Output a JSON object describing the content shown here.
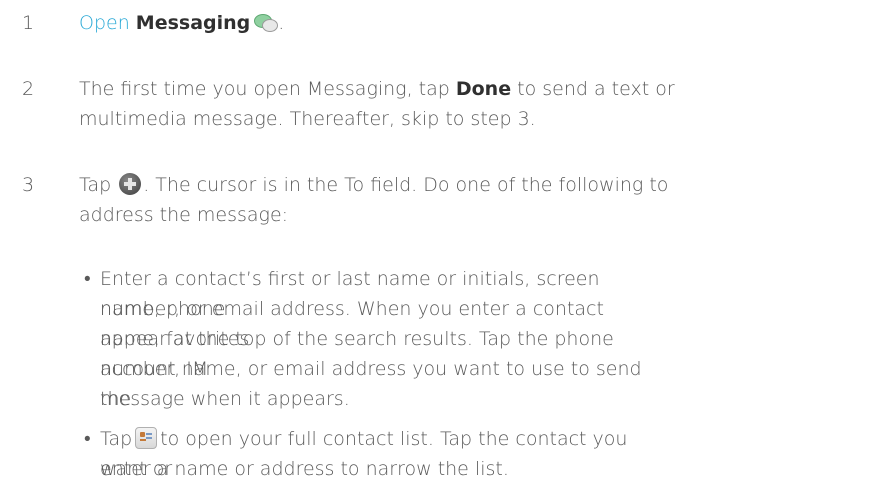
{
  "steps": [
    {
      "number": "1",
      "open_word": "Open",
      "app_name": "Messaging",
      "icon": "messaging-icon",
      "end": "."
    },
    {
      "number": "2",
      "before": "The first time you open Messaging, tap",
      "bold": "Done",
      "after_line1": "to send a text or",
      "line2": "multimedia message. Thereafter, skip to step 3."
    },
    {
      "number": "3",
      "tap": "Tap",
      "icon": "new-message-icon",
      "after_line1": ". The cursor is in the To field. Do one of the following to",
      "line2": "address the message:"
    }
  ],
  "bullets": [
    {
      "lines": [
        "Enter a contact’s first or last name or initials, screen name, phone",
        "number, or email address. When you enter a contact name, favorites",
        "appear at the top of the search results. Tap the phone number, IM",
        "account name, or email address you want to use to send the",
        "message when it appears."
      ]
    },
    {
      "tap": "Tap",
      "icon": "contacts-icon",
      "line1_rest": "to open your full contact list. Tap the contact you want or",
      "line2": "enter a name or address to narrow the list."
    }
  ],
  "bullet_char": "•"
}
